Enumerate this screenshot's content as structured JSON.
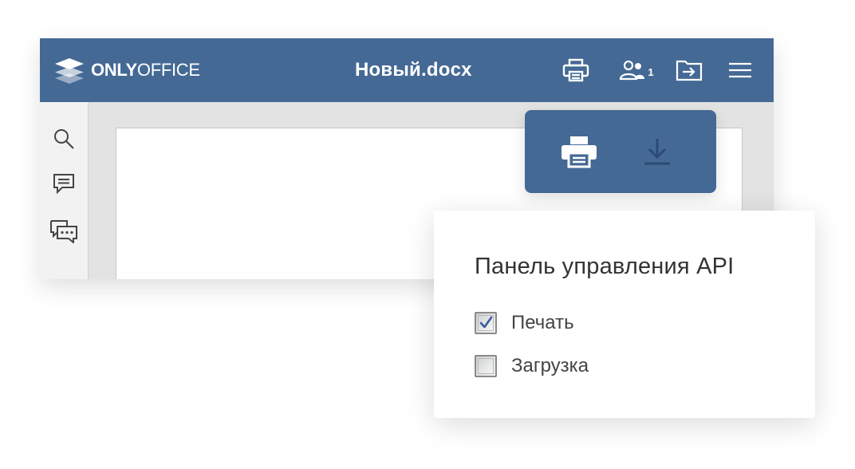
{
  "colors": {
    "header_bg": "#446995",
    "check_mark": "#3b5aa0",
    "download_icon": "#2c4a75"
  },
  "editor": {
    "logo": {
      "brand_bold": "ONLY",
      "brand_light": "OFFICE",
      "icon": "onlyoffice-logo-icon"
    },
    "document_title": "Новый.docx",
    "toolbar": {
      "print_icon": "print-icon",
      "users_icon": "users-icon",
      "users_count": "1",
      "open_location_icon": "open-location-icon",
      "menu_icon": "hamburger-menu-icon"
    },
    "sidebar": {
      "items": [
        {
          "icon": "search-icon"
        },
        {
          "icon": "comments-icon"
        },
        {
          "icon": "chat-icon"
        }
      ]
    }
  },
  "api_buttons": {
    "items": [
      {
        "icon": "print-icon"
      },
      {
        "icon": "download-icon"
      }
    ]
  },
  "api_panel": {
    "title": "Панель управления API",
    "options": [
      {
        "label": "Печать",
        "checked": true
      },
      {
        "label": "Загрузка",
        "checked": false
      }
    ]
  }
}
